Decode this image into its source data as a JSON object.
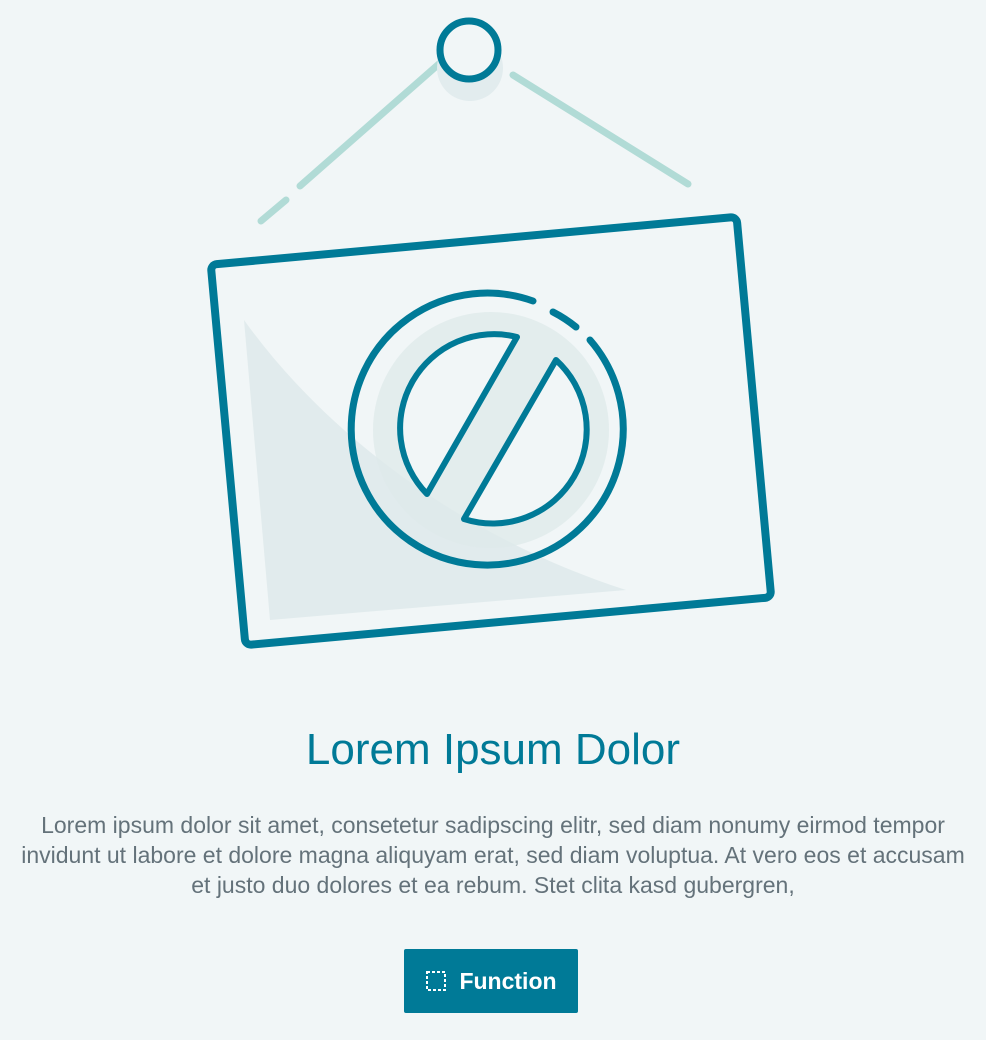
{
  "empty_state": {
    "title": "Lorem Ipsum Dolor",
    "body": "Lorem ipsum dolor sit amet, consetetur sadipscing elitr, sed diam nonumy eirmod tempor invidunt ut labore et dolore magna aliquyam erat, sed diam voluptua. At vero eos et accusam et justo duo dolores et ea rebum. Stet clita kasd gubergren,",
    "button_label": "Function",
    "button_icon": "dashed-square-icon",
    "illustration_icon": "prohibited-sign-icon"
  },
  "colors": {
    "background": "#f1f6f7",
    "accent": "#007a97",
    "accent_light": "#b1dbd6",
    "shade": "#dde9ea",
    "text": "#64727a"
  }
}
